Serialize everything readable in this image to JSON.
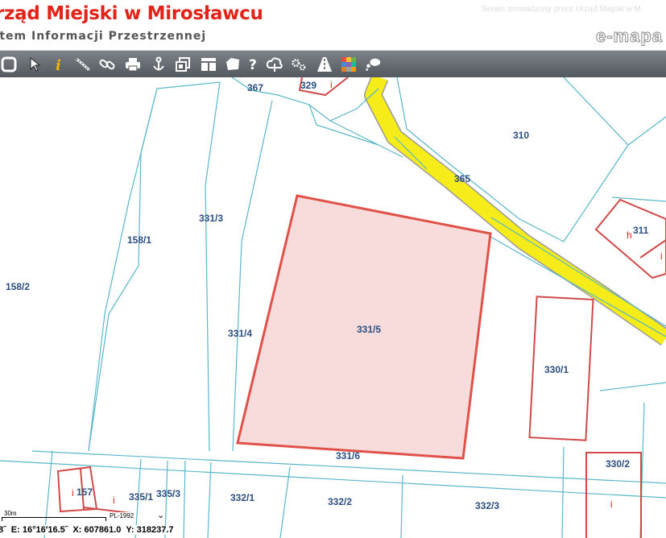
{
  "header": {
    "title": "rząd Miejski w Mirosławcu",
    "subtitle": "stem Informacji Przestrzennej",
    "service": "Serwis prowadzony przez Urząd Miejski w M",
    "brand": "e-mapa"
  },
  "toolbar": {
    "icons": [
      "fullscreen-icon",
      "pointer-icon",
      "info-icon",
      "measure-icon",
      "link-icon",
      "print-icon",
      "download-icon",
      "layers-icon",
      "layout-icon",
      "select-area-icon",
      "help-icon",
      "upload-icon",
      "settings-icon",
      "road-icon",
      "palette-icon",
      "comment-icon"
    ]
  },
  "map": {
    "parcels": [
      "367",
      "329",
      "310",
      "365",
      "311",
      "158/1",
      "331/3",
      "158/2",
      "331/4",
      "331/5",
      "330/1",
      "331/6",
      "330/2",
      "157",
      "335/1",
      "335/3",
      "332/1",
      "332/2",
      "332/3"
    ],
    "building_labels": [
      "i",
      "h",
      "i",
      "i",
      "i",
      "i"
    ],
    "colors": {
      "parcel_line": "#5ab7c9",
      "highlight_fill": "#f8dcdb",
      "highlight_stroke": "#e05149",
      "road_fill": "#f6ec1a",
      "road_edge": "#9a9a9a",
      "label": "#2c4f80"
    }
  },
  "footer": {
    "scale_label": "30m",
    "crs": "PL-1992",
    "coord_prefix": "8˝",
    "coord_e": "E: 16°16′16.5˝",
    "coord_x": "X: 607861.0",
    "coord_y": "Y: 318237.7"
  }
}
